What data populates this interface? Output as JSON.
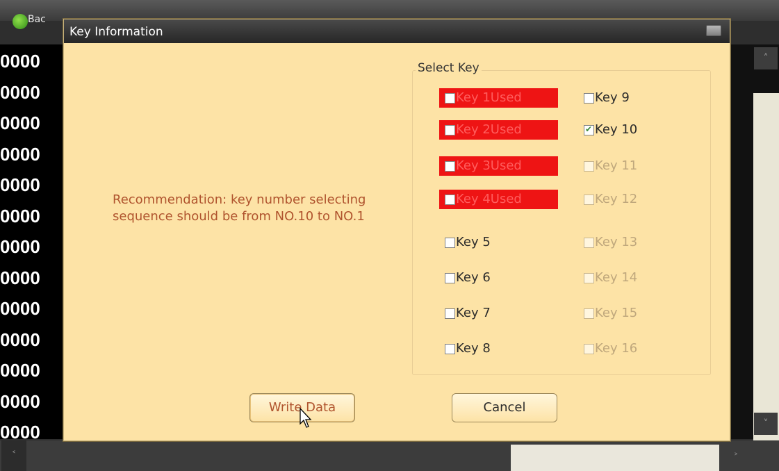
{
  "background": {
    "title": "Bac",
    "row_text": "0000",
    "row_count": 13,
    "scroll_up_glyph": "˄",
    "scroll_down_glyph": "˅",
    "scroll_left_glyph": "˂",
    "scroll_right_glyph": "˃"
  },
  "dialog": {
    "title": "Key Information",
    "recommendation": "Recommendation: key number selecting sequence should be from NO.10 to NO.1",
    "group_label": "Select Key",
    "write_button": "Write Data",
    "cancel_button": "Cancel"
  },
  "keys": [
    {
      "label": "Key 1Used",
      "state": "used",
      "checked": false
    },
    {
      "label": "Key 2Used",
      "state": "used",
      "checked": false
    },
    {
      "label": "Key 3Used",
      "state": "used",
      "checked": false
    },
    {
      "label": "Key 4Used",
      "state": "used",
      "checked": false
    },
    {
      "label": "Key 5",
      "state": "enabled",
      "checked": false
    },
    {
      "label": "Key 6",
      "state": "enabled",
      "checked": false
    },
    {
      "label": "Key 7",
      "state": "enabled",
      "checked": false
    },
    {
      "label": "Key 8",
      "state": "enabled",
      "checked": false
    },
    {
      "label": "Key 9",
      "state": "enabled",
      "checked": false
    },
    {
      "label": "Key 10",
      "state": "enabled",
      "checked": true
    },
    {
      "label": "Key 11",
      "state": "disabled",
      "checked": false
    },
    {
      "label": "Key 12",
      "state": "disabled",
      "checked": false
    },
    {
      "label": "Key 13",
      "state": "disabled",
      "checked": false
    },
    {
      "label": "Key 14",
      "state": "disabled",
      "checked": false
    },
    {
      "label": "Key 15",
      "state": "disabled",
      "checked": false
    },
    {
      "label": "Key 16",
      "state": "disabled",
      "checked": false
    }
  ],
  "colors": {
    "dialog_bg": "#fde3a6",
    "used_bg": "#ee1414",
    "recommendation_text": "#b0542e"
  }
}
